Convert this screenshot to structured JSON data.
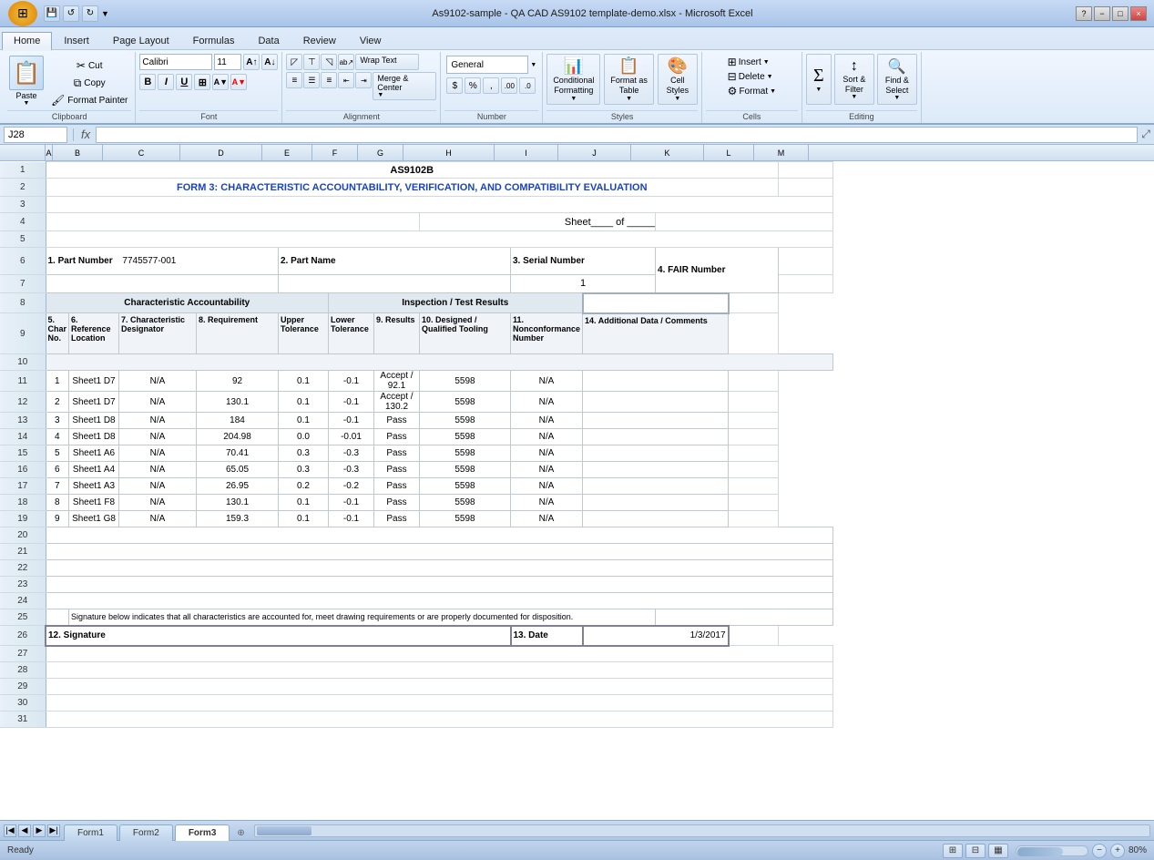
{
  "window": {
    "title": "As9102-sample - QA CAD AS9102 template-demo.xlsx - Microsoft Excel",
    "minimize": "−",
    "maximize": "□",
    "close": "×"
  },
  "ribbon": {
    "tabs": [
      "Home",
      "Insert",
      "Page Layout",
      "Formulas",
      "Data",
      "Review",
      "View"
    ],
    "active_tab": "Home",
    "groups": {
      "clipboard": "Clipboard",
      "font": "Font",
      "alignment": "Alignment",
      "number": "Number",
      "styles": "Styles",
      "cells": "Cells",
      "editing": "Editing"
    },
    "buttons": {
      "paste": "Paste",
      "cut": "Cut",
      "copy": "Copy",
      "format_painter": "Format Painter",
      "bold": "B",
      "italic": "I",
      "underline": "U",
      "font_name": "Calibri",
      "font_size": "11",
      "wrap_text": "Wrap Text",
      "merge_center": "Merge & Center",
      "number_format": "General",
      "conditional_format": "Conditional Formatting",
      "format_as_table": "Format as Table",
      "cell_styles": "Cell Styles",
      "insert": "Insert",
      "delete": "Delete",
      "format": "Format",
      "sum": "Σ",
      "sort_filter": "Sort & Filter",
      "find_select": "Find & Select"
    }
  },
  "formula_bar": {
    "name_box": "J28",
    "fx": "fx",
    "formula": ""
  },
  "spreadsheet": {
    "title_row": "AS9102B",
    "form_title": "FORM 3: CHARACTERISTIC ACCOUNTABILITY, VERIFICATION, AND COMPATIBILITY EVALUATION",
    "sheet_label": "Sheet",
    "of_label": "of",
    "part_number_label": "1. Part Number",
    "part_number_value": "7745577-001",
    "part_name_label": "2. Part Name",
    "serial_number_label": "3. Serial Number",
    "serial_number_value": "1",
    "fair_number_label": "4. FAIR Number",
    "char_accountability_label": "Characteristic Accountability",
    "inspection_results_label": "Inspection / Test Results",
    "col_headers": [
      {
        "num": "5. Char No."
      },
      {
        "num": "6. Reference Location"
      },
      {
        "num": "7. Characteristic Designator"
      },
      {
        "num": "8. Requirement"
      },
      {
        "num": "Upper Tolerance"
      },
      {
        "num": "Lower Tolerance"
      },
      {
        "num": "9. Results"
      },
      {
        "num": "10. Designed / Qualified Tooling"
      },
      {
        "num": "11. Nonconformance Number"
      },
      {
        "num": "14. Additional Data / Comments"
      }
    ],
    "data_rows": [
      {
        "char": "1",
        "ref": "Sheet1  D7",
        "des": "N/A",
        "req": "92",
        "upper": "0.1",
        "lower": "-0.1",
        "result": "Accept / 92.1",
        "tooling": "5598",
        "nonconf": "N/A",
        "comments": ""
      },
      {
        "char": "2",
        "ref": "Sheet1  D7",
        "des": "N/A",
        "req": "130.1",
        "upper": "0.1",
        "lower": "-0.1",
        "result": "Accept / 130.2",
        "tooling": "5598",
        "nonconf": "N/A",
        "comments": ""
      },
      {
        "char": "3",
        "ref": "Sheet1  D8",
        "des": "N/A",
        "req": "184",
        "upper": "0.1",
        "lower": "-0.1",
        "result": "Pass",
        "tooling": "5598",
        "nonconf": "N/A",
        "comments": ""
      },
      {
        "char": "4",
        "ref": "Sheet1  D8",
        "des": "N/A",
        "req": "204.98",
        "upper": "0.0",
        "lower": "-0.01",
        "result": "Pass",
        "tooling": "5598",
        "nonconf": "N/A",
        "comments": ""
      },
      {
        "char": "5",
        "ref": "Sheet1  A6",
        "des": "N/A",
        "req": "70.41",
        "upper": "0.3",
        "lower": "-0.3",
        "result": "Pass",
        "tooling": "5598",
        "nonconf": "N/A",
        "comments": ""
      },
      {
        "char": "6",
        "ref": "Sheet1  A4",
        "des": "N/A",
        "req": "65.05",
        "upper": "0.3",
        "lower": "-0.3",
        "result": "Pass",
        "tooling": "5598",
        "nonconf": "N/A",
        "comments": ""
      },
      {
        "char": "7",
        "ref": "Sheet1  A3",
        "des": "N/A",
        "req": "26.95",
        "upper": "0.2",
        "lower": "-0.2",
        "result": "Pass",
        "tooling": "5598",
        "nonconf": "N/A",
        "comments": ""
      },
      {
        "char": "8",
        "ref": "Sheet1  F8",
        "des": "N/A",
        "req": "130.1",
        "upper": "0.1",
        "lower": "-0.1",
        "result": "Pass",
        "tooling": "5598",
        "nonconf": "N/A",
        "comments": ""
      },
      {
        "char": "9",
        "ref": "Sheet1  G8",
        "des": "N/A",
        "req": "159.3",
        "upper": "0.1",
        "lower": "-0.1",
        "result": "Pass",
        "tooling": "5598",
        "nonconf": "N/A",
        "comments": ""
      }
    ],
    "empty_rows": [
      20,
      21,
      22,
      23,
      24
    ],
    "signature_note": "Signature below indicates that all characteristics are accounted for, meet drawing requirements or are properly documented for disposition.",
    "signature_label": "12. Signature",
    "date_label": "13. Date",
    "date_value": "1/3/2017"
  },
  "sheet_tabs": [
    "Form1",
    "Form2",
    "Form3"
  ],
  "active_sheet": "Form3",
  "status": {
    "ready": "Ready",
    "zoom": "80%"
  },
  "col_widths": {
    "A": 8,
    "B": 55,
    "C": 80,
    "D": 90,
    "E": 60,
    "F": 55,
    "G": 55,
    "H": 100,
    "I": 70,
    "J": 80,
    "K": 80,
    "L": 50,
    "M": 60
  }
}
